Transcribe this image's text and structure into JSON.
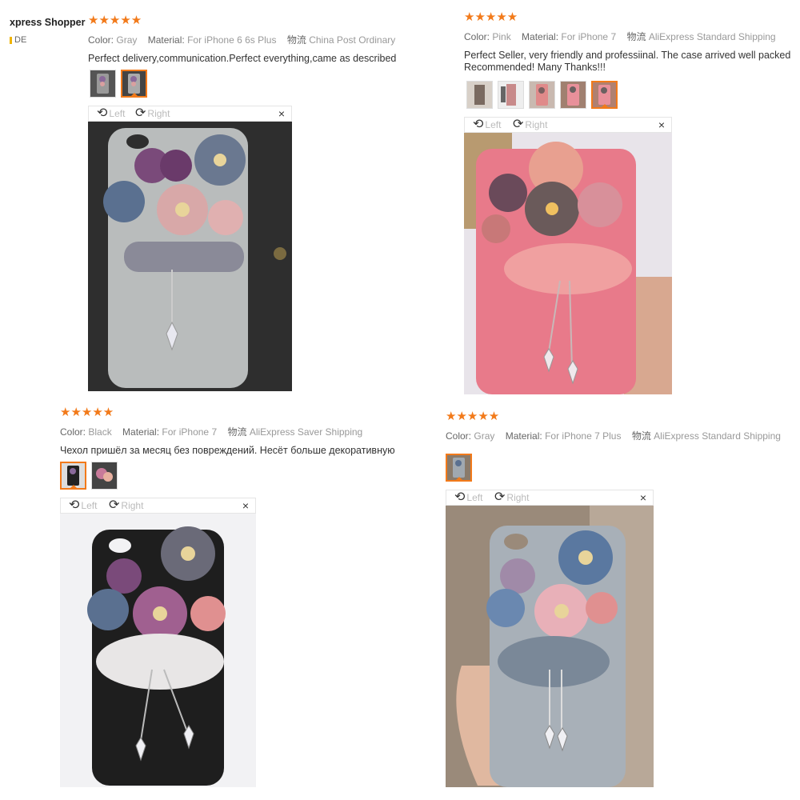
{
  "reviewer": {
    "name": "xpress Shopper",
    "country": "DE"
  },
  "labels": {
    "color": "Color:",
    "material": "Material:",
    "shipping": "物流",
    "rotate_left": "Left",
    "rotate_right": "Right",
    "close": "×"
  },
  "reviews": [
    {
      "rating": 5,
      "stars": "★★★★★",
      "color": "Gray",
      "material": "For iPhone 6 6s Plus",
      "shipping": "China Post Ordinary",
      "text": "Perfect delivery,communication.Perfect everything,came as described"
    },
    {
      "rating": 5,
      "stars": "★★★★★",
      "color": "Pink",
      "material": "For iPhone 7",
      "shipping": "AliExpress Standard Shipping",
      "text_line1": "Perfect Seller, very friendly and professiinal. The case arrived well packed",
      "text_line2": "Recommended! Many Thanks!!!"
    },
    {
      "rating": 5,
      "stars": "★★★★★",
      "color": "Black",
      "material": "For iPhone 7",
      "shipping": "AliExpress Saver Shipping",
      "text": "Чехол пришёл за месяц без повреждений. Несёт больше декоративную ("
    },
    {
      "rating": 5,
      "stars": "★★★★★",
      "color": "Gray",
      "material": "For iPhone 7 Plus",
      "shipping": "AliExpress Standard Shipping",
      "text": ""
    }
  ],
  "icons": {
    "rotate_left": "rotate-left-icon",
    "rotate_right": "rotate-right-icon",
    "close": "close-icon",
    "star": "star-icon"
  },
  "colors": {
    "accent": "#f27a1a",
    "muted": "#999999"
  }
}
